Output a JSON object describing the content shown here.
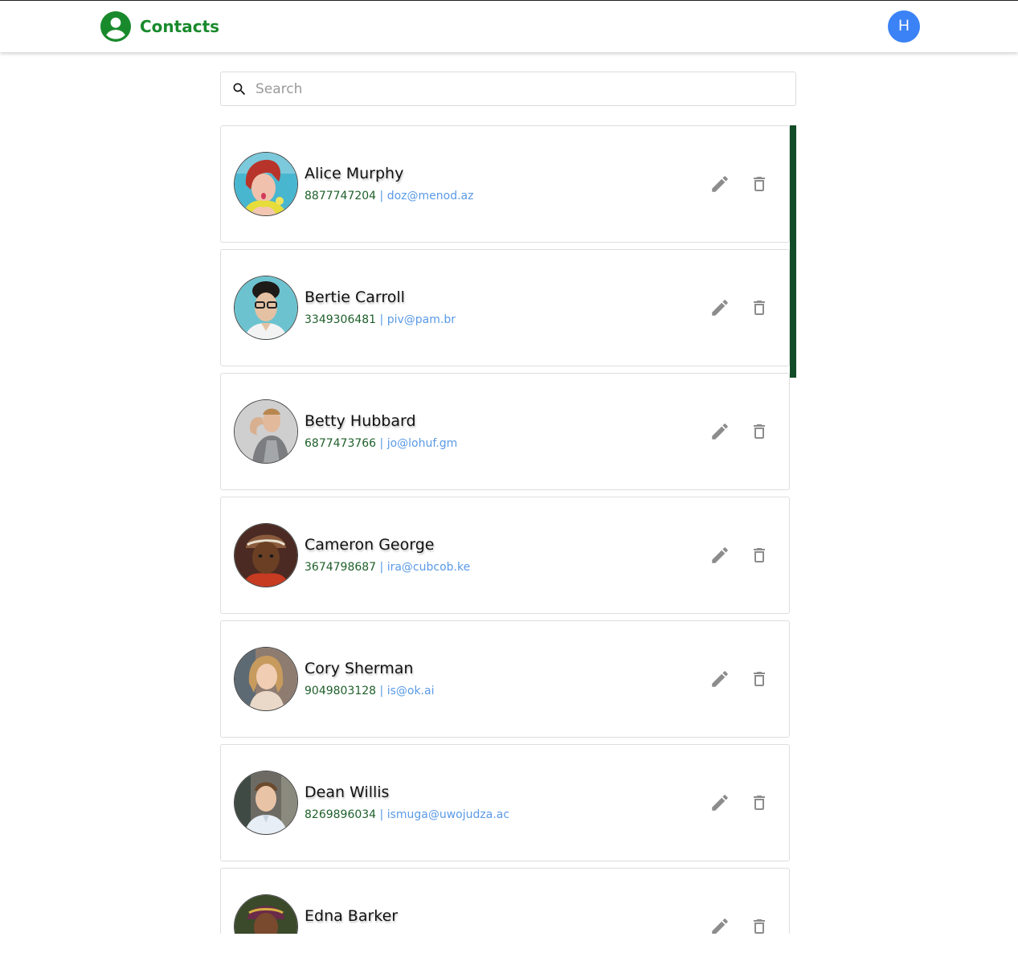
{
  "header": {
    "title": "Contacts",
    "brand_icon": "account-circle-icon",
    "user_initial": "H",
    "brand_color": "#198a2c",
    "avatar_color": "#3b82f6"
  },
  "search": {
    "placeholder": "Search",
    "value": "",
    "icon": "search-icon"
  },
  "contacts": [
    {
      "name": "Alice Murphy",
      "phone": "8877747204",
      "separator": "|",
      "email": "doz@menod.az"
    },
    {
      "name": "Bertie Carroll",
      "phone": "3349306481",
      "separator": "|",
      "email": "piv@pam.br"
    },
    {
      "name": "Betty Hubbard",
      "phone": "6877473766",
      "separator": "|",
      "email": "jo@lohuf.gm"
    },
    {
      "name": "Cameron George",
      "phone": "3674798687",
      "separator": "|",
      "email": "ira@cubcob.ke"
    },
    {
      "name": "Cory Sherman",
      "phone": "9049803128",
      "separator": "|",
      "email": "is@ok.ai"
    },
    {
      "name": "Dean Willis",
      "phone": "8269896034",
      "separator": "|",
      "email": "ismuga@uwojudza.ac"
    },
    {
      "name": "Edna Barker",
      "phone": "",
      "separator": "",
      "email": ""
    }
  ],
  "actions": {
    "edit_icon": "pencil-icon",
    "delete_icon": "trash-icon"
  },
  "colors": {
    "phone": "#1e5f2a",
    "email": "#5a9ae6",
    "scrollbar": "#124d27"
  }
}
